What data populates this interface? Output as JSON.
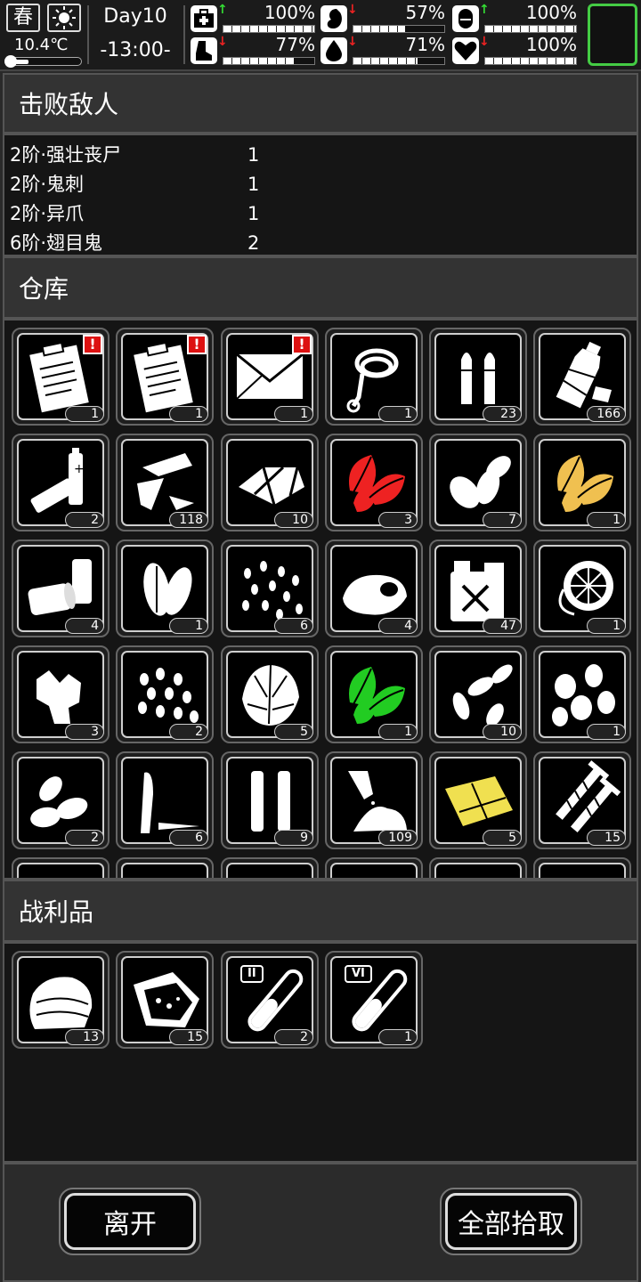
{
  "status": {
    "season": "春",
    "temperature": "10.4℃",
    "day": "Day10",
    "time": "-13:00-",
    "stats": [
      {
        "icon": "medkit-icon",
        "arrow": "up",
        "pct": "100%",
        "value": 1.0
      },
      {
        "icon": "stomach-icon",
        "arrow": "down",
        "pct": "57%",
        "value": 0.57
      },
      {
        "icon": "pill-icon",
        "arrow": "up",
        "pct": "100%",
        "value": 1.0
      },
      {
        "icon": "foot-icon",
        "arrow": "down",
        "pct": "77%",
        "value": 0.77
      },
      {
        "icon": "water-drop-icon",
        "arrow": "down",
        "pct": "71%",
        "value": 0.71
      },
      {
        "icon": "heart-icon",
        "arrow": "down",
        "pct": "100%",
        "value": 1.0
      }
    ]
  },
  "enemies": {
    "title": "击败敌人",
    "rows": [
      {
        "name": "2阶·强壮丧尸",
        "count": "1"
      },
      {
        "name": "2阶·鬼刺",
        "count": "1"
      },
      {
        "name": "2阶·异爪",
        "count": "1"
      },
      {
        "name": "6阶·翅目鬼",
        "count": "2"
      }
    ]
  },
  "storage": {
    "title": "仓库",
    "items": [
      {
        "icon": "clipboard-icon",
        "count": "1",
        "alert": "!"
      },
      {
        "icon": "clipboard-icon",
        "count": "1",
        "alert": "!"
      },
      {
        "icon": "envelope-icon",
        "count": "1",
        "alert": "!"
      },
      {
        "icon": "rope-icon",
        "count": "1"
      },
      {
        "icon": "bullets-icon",
        "count": "23"
      },
      {
        "icon": "plastic-bottle-icon",
        "count": "166"
      },
      {
        "icon": "battery-icon",
        "count": "2"
      },
      {
        "icon": "glass-shards-icon",
        "count": "118"
      },
      {
        "icon": "broken-tiles-icon",
        "count": "10"
      },
      {
        "icon": "red-herb-icon",
        "count": "3"
      },
      {
        "icon": "seeds-icon",
        "count": "7"
      },
      {
        "icon": "yellow-herb-icon",
        "count": "1"
      },
      {
        "icon": "can-icon",
        "count": "4"
      },
      {
        "icon": "beans-icon",
        "count": "1"
      },
      {
        "icon": "small-seeds-icon",
        "count": "6"
      },
      {
        "icon": "stone-icon",
        "count": "4"
      },
      {
        "icon": "fuel-can-icon",
        "count": "47"
      },
      {
        "icon": "fan-icon",
        "count": "1"
      },
      {
        "icon": "ginger-icon",
        "count": "3"
      },
      {
        "icon": "grain-icon",
        "count": "2"
      },
      {
        "icon": "cabbage-icon",
        "count": "5"
      },
      {
        "icon": "green-herb-icon",
        "count": "1"
      },
      {
        "icon": "sunflower-seeds-icon",
        "count": "10"
      },
      {
        "icon": "nuts-icon",
        "count": "1"
      },
      {
        "icon": "almonds-icon",
        "count": "2"
      },
      {
        "icon": "knife-icon",
        "count": "6"
      },
      {
        "icon": "tubes-icon",
        "count": "9"
      },
      {
        "icon": "powder-icon",
        "count": "109"
      },
      {
        "icon": "yellow-cloth-icon",
        "count": "5"
      },
      {
        "icon": "screws-icon",
        "count": "15"
      }
    ]
  },
  "loot": {
    "title": "战利品",
    "items": [
      {
        "icon": "cloth-icon",
        "count": "13"
      },
      {
        "icon": "meat-icon",
        "count": "15"
      },
      {
        "icon": "test-tube-icon",
        "count": "2",
        "tier": "II"
      },
      {
        "icon": "test-tube-icon",
        "count": "1",
        "tier": "VI"
      }
    ]
  },
  "actions": {
    "leave": "离开",
    "take_all": "全部拾取"
  }
}
